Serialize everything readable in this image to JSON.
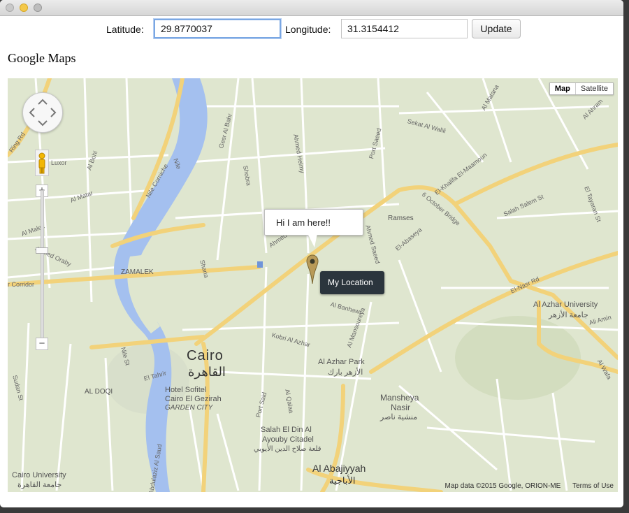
{
  "form": {
    "latitude_label": "Latitude:",
    "latitude_value": "29.8770037",
    "longitude_label": "Longitude:",
    "longitude_value": "31.3154412",
    "update_label": "Update"
  },
  "page": {
    "title": "Google Maps"
  },
  "map": {
    "type_controls": {
      "map": "Map",
      "satellite": "Satellite"
    },
    "info_window_text": "Hi I am here!!",
    "marker_tooltip": "My Location",
    "footer": {
      "attribution": "Map data ©2015 Google, ORION-ME",
      "terms": "Terms of Use"
    },
    "places": {
      "cairo_en": "Cairo",
      "cairo_ar": "القاهرة",
      "al_azhar_univ": "Al Azhar University",
      "al_azhar_univ_ar": "جامعة الأزهر",
      "al_azhar_park": "Al Azhar Park",
      "al_azhar_park_ar": "الأزهر بارك",
      "mansheya": "Mansheya",
      "nasir": "Nasir",
      "mansheya_ar": "منشية ناصر",
      "salah_el_din": "Salah El Din Al",
      "ayouby": "Ayouby Citadel",
      "citadel_ar": "قلعة صلاح الدين الأيوبي",
      "abajiyyah": "Al Abajiyyah",
      "abajiyyah_ar": "الأباجية",
      "hotel_sofitel": "Hotel Sofitel",
      "cairo_el_gezirah": "Cairo El Gezirah",
      "garden_city": "GARDEN CITY",
      "zamalek": "ZAMALEK",
      "al_dooi": "AL DOQI",
      "cairo_university": "Cairo University",
      "cairo_university_ar": "جامعة القاهرة",
      "ramses": "Ramses",
      "el_abaseya": "El-Abaseya"
    },
    "roads": {
      "ring_rd": "Ring Rd",
      "luxor": "Luxor",
      "al_bohi": "Al Bohi",
      "al_matar": "Al Matar",
      "al_malek": "Al Malek",
      "ahmed_oraby": "Ahmed Oraby",
      "corridor": "r Corridor",
      "gesr_al_bahr": "Gesr Al Bahr",
      "shobra": "Shobra",
      "ahmed_helmy": "Ahmed Helmy",
      "port_saeed": "Port Saeed",
      "sekat_al_walili": "Sekat Al Walili",
      "el_khalifa": "El-Khalifa El-Maamoun",
      "al_matana": "Al Matana",
      "al_ahram": "Al Ahram",
      "salah_salem": "Salah Salem St",
      "six_october": "6 October Bridge",
      "el_tayaran": "El Tayaran St",
      "el_nasr": "El-Nasr Rd",
      "nile_corniche": "Nile Corniche",
      "nile": "Nile",
      "sharia": "Sharia",
      "ahmed_maher": "Ahmed",
      "al_banhawi": "Al Banhawi",
      "kobri_al_azhar": "Kobri Al Azhar",
      "al_mansoureya": "Al Mansoureya",
      "el_tahrir": "El Tahrir",
      "nile_st": "Nile St",
      "sudan_st": "Sudan St",
      "port_said": "Port Said",
      "al_qalaa": "Al Qalaa",
      "abdulaziz": "Abdulaziz Al Saud",
      "ali_amin": "Ali Amin",
      "al_wafa": "Al Wafa",
      "ahmed_saeed": "Ahmed Saeed"
    }
  }
}
